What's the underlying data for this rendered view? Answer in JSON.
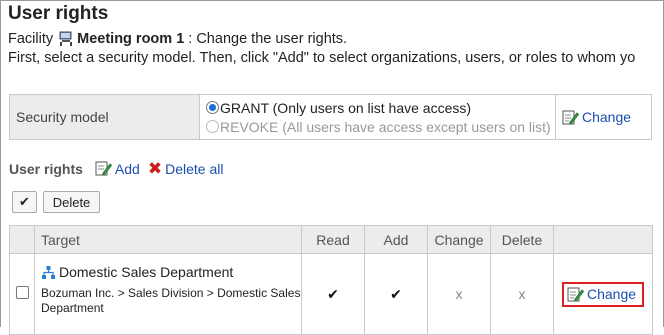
{
  "title": "User rights",
  "facility": {
    "prefix": "Facility",
    "name": "Meeting room 1",
    "suffix": ": Change the user rights.",
    "instruction": "First, select a security model. Then, click \"Add\" to select organizations, users, or roles to whom yo"
  },
  "security_model": {
    "label": "Security model",
    "grant_label": "GRANT (Only users on list have access)",
    "revoke_label": "REVOKE (All users have access except users on list)",
    "selected": "GRANT",
    "change_label": "Change"
  },
  "user_rights": {
    "heading": "User rights",
    "add_label": "Add",
    "delete_all_label": "Delete all",
    "check_all_label": "✔",
    "delete_label": "Delete"
  },
  "table": {
    "headers": [
      "Target",
      "Read",
      "Add",
      "Change",
      "Delete"
    ],
    "rows": [
      {
        "target": "Domestic Sales Department",
        "path": "Bozuman Inc. > Sales Division > Domestic Sales Department",
        "read": "✔",
        "add": "✔",
        "change": "x",
        "delete": "x",
        "action": "Change"
      }
    ]
  },
  "colors": {
    "link": "#1a4fb0",
    "highlight_border": "#e02020",
    "header_bg": "#ececec"
  },
  "icons": [
    "facility-icon",
    "edit-icon",
    "delete-x-icon",
    "organization-icon"
  ]
}
